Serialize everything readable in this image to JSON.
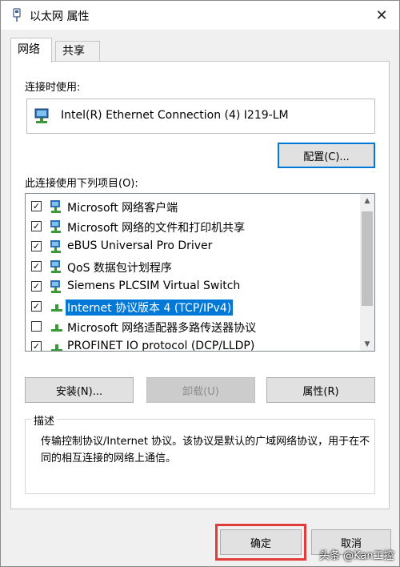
{
  "window": {
    "title": "以太网 属性",
    "close_label": "✕"
  },
  "tabs": [
    {
      "label": "网络"
    },
    {
      "label": "共享"
    }
  ],
  "connect_using": {
    "label": "连接时使用:",
    "adapter": "Intel(R) Ethernet Connection (4) I219-LM",
    "configure_label": "配置(C)..."
  },
  "items_section": {
    "label": "此连接使用下列项目(O):",
    "items": [
      {
        "label": "Microsoft 网络客户端",
        "checked": true,
        "icon": "network-client-icon"
      },
      {
        "label": "Microsoft 网络的文件和打印机共享",
        "checked": true,
        "icon": "network-service-icon"
      },
      {
        "label": "eBUS Universal Pro Driver",
        "checked": true,
        "icon": "network-service-icon"
      },
      {
        "label": "QoS 数据包计划程序",
        "checked": true,
        "icon": "network-service-icon"
      },
      {
        "label": "Siemens PLCSIM Virtual Switch",
        "checked": true,
        "icon": "network-service-icon"
      },
      {
        "label": "Internet 协议版本 4 (TCP/IPv4)",
        "checked": true,
        "selected": true,
        "icon": "protocol-icon"
      },
      {
        "label": "Microsoft 网络适配器多路传送器协议",
        "checked": false,
        "icon": "protocol-icon"
      },
      {
        "label": "PROFINET IO protocol (DCP/LLDP)",
        "checked": true,
        "icon": "protocol-icon"
      }
    ]
  },
  "actions": {
    "install": "安装(N)...",
    "uninstall": "卸载(U)",
    "properties": "属性(R)"
  },
  "description": {
    "title": "描述",
    "text": "传输控制协议/Internet 协议。该协议是默认的广域网络协议，用于在不同的相互连接的网络上通信。"
  },
  "footer": {
    "ok": "确定",
    "cancel": "取消"
  },
  "watermark": "头条 @Kan工控",
  "colors": {
    "accent": "#0078d7",
    "highlight_box": "#e23b3b"
  }
}
